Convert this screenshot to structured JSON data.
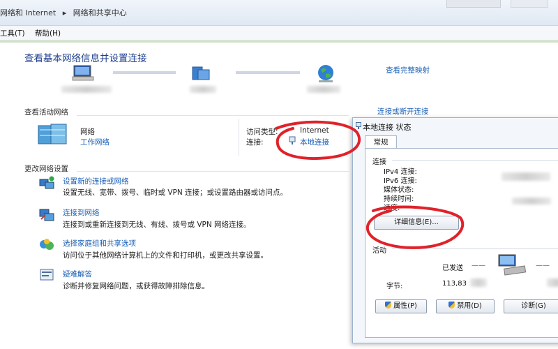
{
  "address_bar": {
    "crumb1": "网络和 Internet",
    "crumb2": "网络和共享中心",
    "separator": "▸"
  },
  "menu": {
    "tools": "工具(T)",
    "help": "帮助(H)"
  },
  "main": {
    "title": "查看基本网络信息并设置连接",
    "view_full_map": "查看完整映射",
    "active_networks_header": "查看活动网络",
    "connect_disconnect": "连接或断开连接",
    "network_name": "网络",
    "network_type": "工作网络",
    "access_type_label": "访问类型:",
    "access_type_value": "Internet",
    "connection_label": "连接:",
    "connection_value": "本地连接",
    "change_settings_header": "更改网络设置",
    "tasks": [
      {
        "title": "设置新的连接或网络",
        "desc": "设置无线、宽带、拨号、临时或 VPN 连接；或设置路由器或访问点。",
        "icon": "new-connection-icon"
      },
      {
        "title": "连接到网络",
        "desc": "连接到或重新连接到无线、有线、拨号或 VPN 网络连接。",
        "icon": "connect-network-icon"
      },
      {
        "title": "选择家庭组和共享选项",
        "desc": "访问位于其他网络计算机上的文件和打印机，或更改共享设置。",
        "icon": "homegroup-icon"
      },
      {
        "title": "疑难解答",
        "desc": "诊断并修复网络问题，或获得故障排除信息。",
        "icon": "troubleshoot-icon"
      }
    ]
  },
  "status_dialog": {
    "title": "本地连接 状态",
    "tab": "常规",
    "connection_header": "连接",
    "ipv4": "IPv4 连接:",
    "ipv6": "IPv6 连接:",
    "media_state": "媒体状态:",
    "duration": "持续时间:",
    "speed": "速度:",
    "details_button": "详细信息(E)...",
    "activity_header": "活动",
    "sent_label": "已发送",
    "sent_dash": "——",
    "bytes_label": "字节:",
    "bytes_value": "113,83",
    "properties_button": "属性(P)",
    "disable_button": "禁用(D)",
    "diagnose_button": "诊断(G)"
  },
  "colors": {
    "link": "#1a5fb4",
    "title": "#1f3f8f",
    "annotation": "#e0222a"
  }
}
